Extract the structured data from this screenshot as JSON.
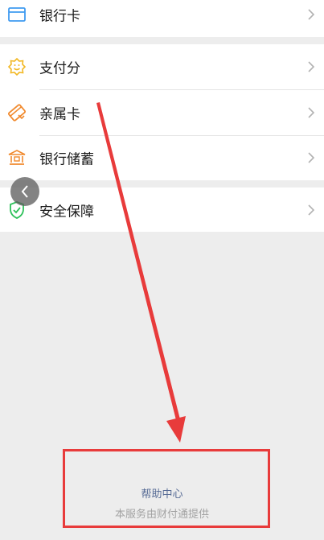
{
  "menu": {
    "bank_card": "银行卡",
    "pay_score": "支付分",
    "family_card": "亲属卡",
    "bank_savings": "银行储蓄",
    "security": "安全保障"
  },
  "footer": {
    "help_center": "帮助中心",
    "provider": "本服务由财付通提供"
  },
  "colors": {
    "background": "#ededed",
    "card": "#ffffff",
    "link": "#576b95",
    "annotation_red": "#e83b3b",
    "icon_blue": "#3f9bf0",
    "icon_yellow": "#f2b824",
    "icon_orange": "#f18a2e",
    "icon_green": "#2ec15a"
  },
  "icons": [
    "bank-card-icon",
    "pay-score-icon",
    "family-card-icon",
    "bank-savings-icon",
    "shield-icon",
    "chevron-right-icon",
    "back-chevron-icon"
  ]
}
